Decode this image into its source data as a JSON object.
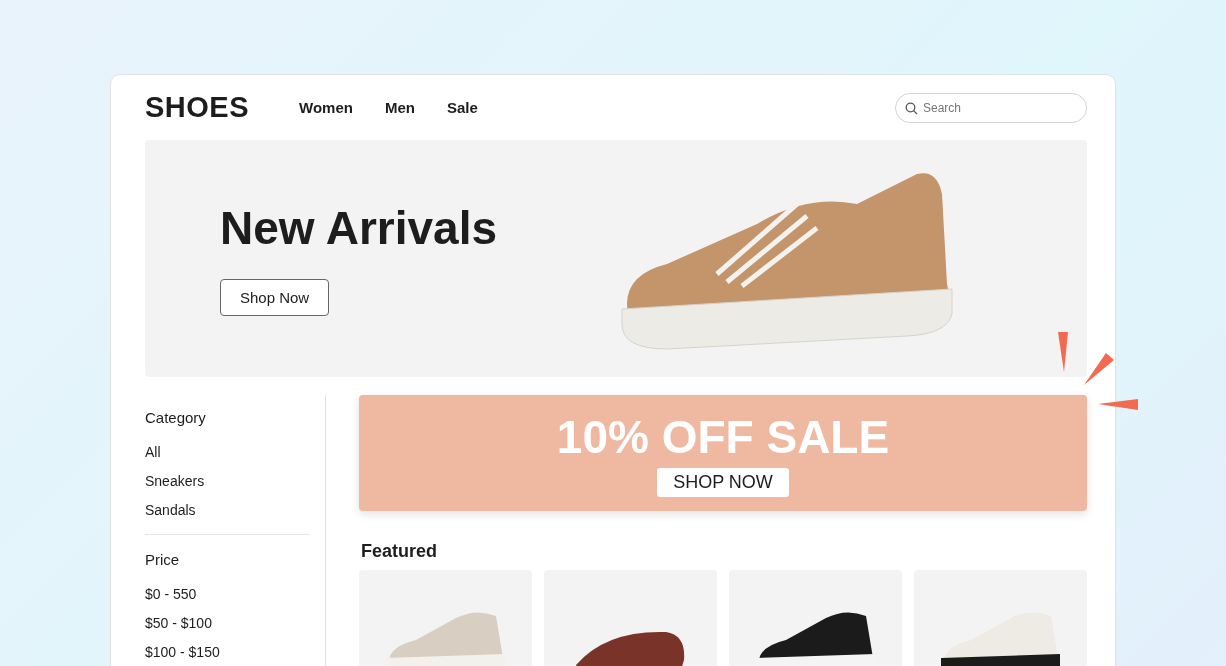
{
  "header": {
    "logo": "SHOES",
    "nav": [
      {
        "label": "Women"
      },
      {
        "label": "Men"
      },
      {
        "label": "Sale"
      }
    ],
    "search": {
      "placeholder": "Search"
    }
  },
  "hero": {
    "title": "New Arrivals",
    "button": "Shop Now"
  },
  "sidebar": {
    "sections": [
      {
        "title": "Category",
        "items": [
          "All",
          "Sneakers",
          "Sandals"
        ]
      },
      {
        "title": "Price",
        "items": [
          "$0 - 550",
          "$50 - $100",
          "$100 - $150"
        ]
      }
    ]
  },
  "promo": {
    "title": "10% OFF SALE",
    "button": "SHOP NOW"
  },
  "featured": {
    "title": "Featured",
    "products": [
      {
        "kind": "sneaker"
      },
      {
        "kind": "slide"
      },
      {
        "kind": "runner"
      },
      {
        "kind": "court"
      }
    ]
  }
}
